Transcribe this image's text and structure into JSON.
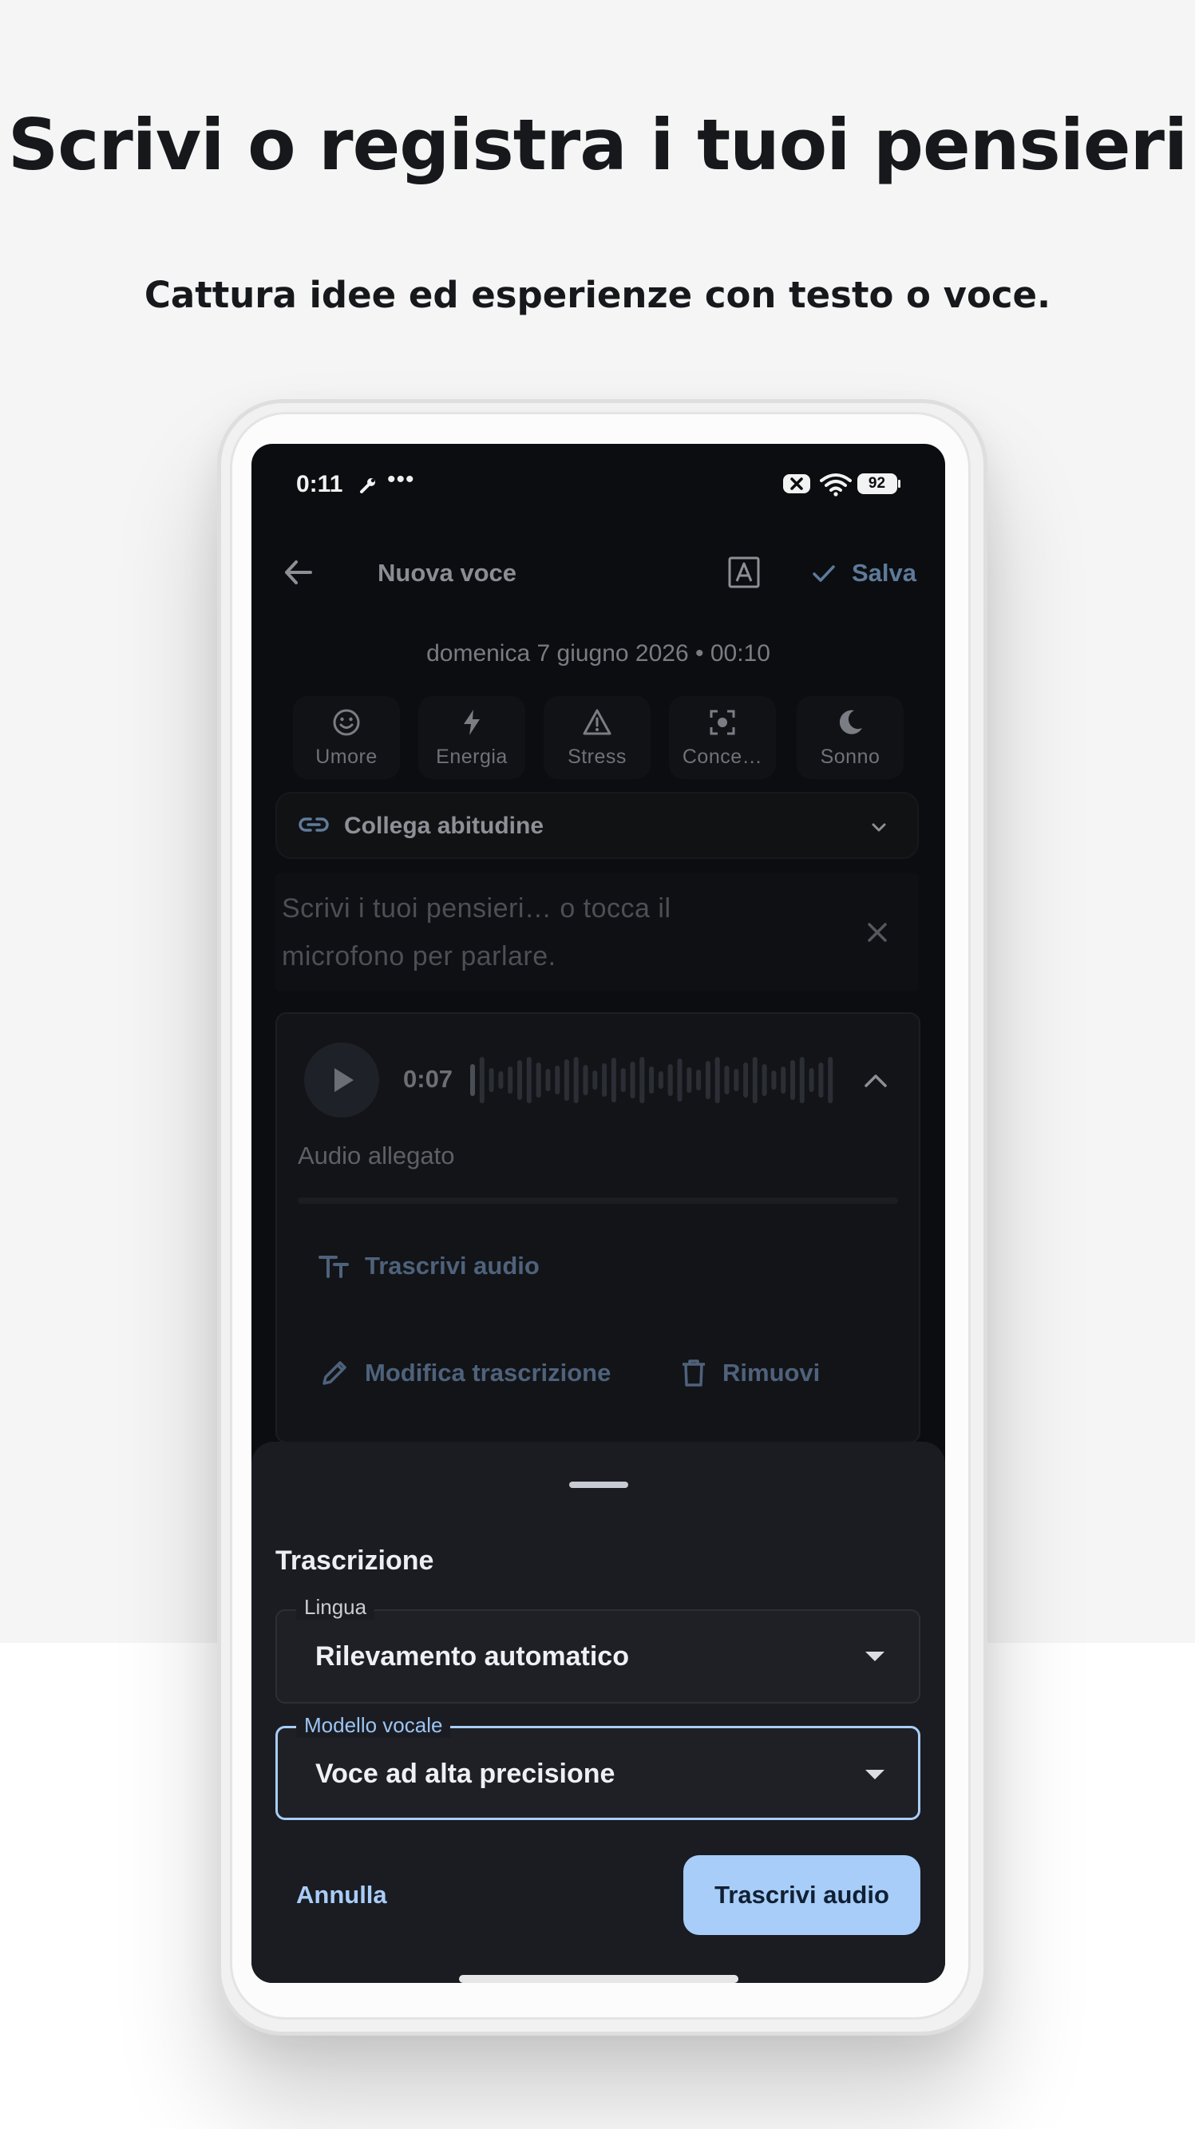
{
  "hero": {
    "title": "Scrivi o registra i tuoi pensieri",
    "subtitle": "Cattura idee ed esperienze con testo o voce."
  },
  "status_bar": {
    "time": "0:11",
    "dots": "•••",
    "battery": "92"
  },
  "top_bar": {
    "title": "Nuova voce",
    "save_label": "Salva"
  },
  "entry": {
    "date": "domenica 7 giugno 2026 • 00:10"
  },
  "metrics": [
    {
      "label": "Umore",
      "icon": "smiley-icon"
    },
    {
      "label": "Energia",
      "icon": "bolt-icon"
    },
    {
      "label": "Stress",
      "icon": "warning-icon"
    },
    {
      "label": "Conce…",
      "icon": "focus-icon"
    },
    {
      "label": "Sonno",
      "icon": "moon-icon"
    }
  ],
  "habit": {
    "label": "Collega abitudine"
  },
  "note": {
    "placeholder": "Scrivi i tuoi pensieri… o tocca il microfono per parlare."
  },
  "audio": {
    "duration": "0:07",
    "attachment_label": "Audio allegato",
    "transcribe_label": "Trascrivi audio",
    "edit_label": "Modifica trascrizione",
    "remove_label": "Rimuovi"
  },
  "sheet": {
    "title": "Trascrizione",
    "language": {
      "label": "Lingua",
      "value": "Rilevamento automatico"
    },
    "model": {
      "label": "Modello vocale",
      "value": "Voce ad alta precisione"
    },
    "cancel_label": "Annulla",
    "confirm_label": "Trascrivi audio"
  },
  "colors": {
    "accent": "#a7cdf8",
    "sheet_bg": "#1a1c22",
    "screen_bg": "#0c0d10",
    "page_bg": "#f5f5f5"
  }
}
